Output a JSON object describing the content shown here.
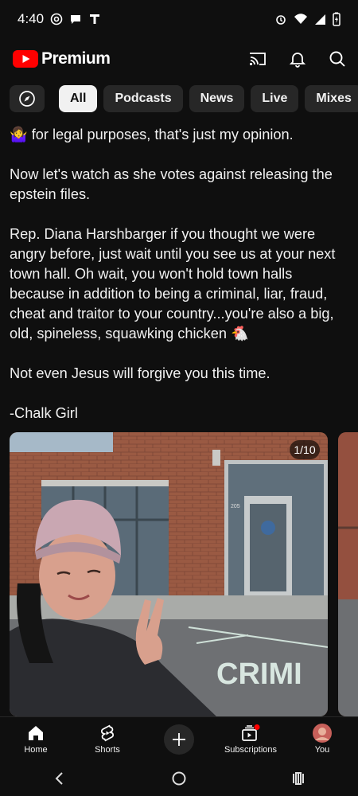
{
  "status": {
    "time": "4:40"
  },
  "header": {
    "brand": "Premium"
  },
  "icons": {
    "cast": "cast-icon",
    "bell": "bell-icon",
    "search": "search-icon",
    "explore": "compass-icon",
    "home": "home-icon",
    "shorts": "shorts-icon",
    "create": "plus-icon",
    "subscriptions": "subscriptions-icon"
  },
  "colors": {
    "brand_red": "#ff0000",
    "background": "#0f0f0f",
    "chip": "#272727",
    "chip_active": "#f1f1f1"
  },
  "chips": [
    "All",
    "Podcasts",
    "News",
    "Live",
    "Mixes"
  ],
  "post": {
    "p1": "🤷‍♀️ for legal purposes, that's just my opinion.",
    "p2": "Now let's watch as she votes against releasing the epstein files.",
    "p3": "Rep. Diana Harshbarger if you thought we were angry before, just wait until you see us at your next town hall. Oh wait, you won't hold town halls because in addition to being a criminal, liar, fraud, cheat and traitor to your country...you're also a big, old, spineless, squawking chicken 🐔",
    "p4": "Not even Jesus will forgive you this time.",
    "p5": "-Chalk Girl"
  },
  "carousel": {
    "counter": "1/10",
    "chalk_text": "CRIMI",
    "door_number": "205"
  },
  "nav": {
    "home": "Home",
    "shorts": "Shorts",
    "subscriptions": "Subscriptions",
    "you": "You"
  }
}
